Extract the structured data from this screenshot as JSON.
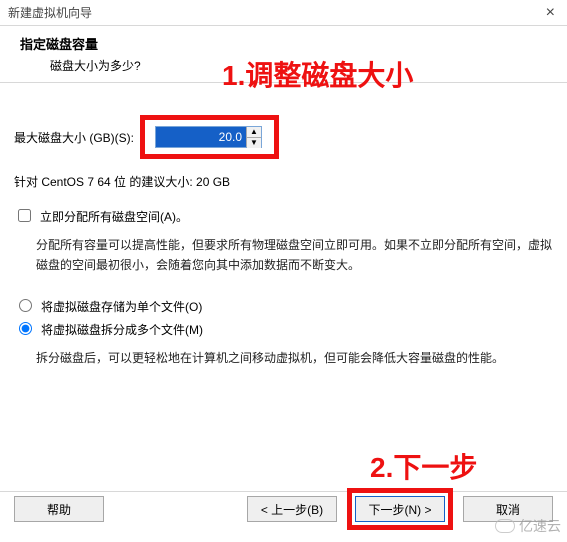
{
  "window": {
    "title": "新建虚拟机向导",
    "close_glyph": "×"
  },
  "header": {
    "title": "指定磁盘容量",
    "subtitle": "磁盘大小为多少?"
  },
  "disk": {
    "label": "最大磁盘大小 (GB)(S):",
    "value": "20.0",
    "spin_up": "▲",
    "spin_down": "▼",
    "recommendation": "针对 CentOS 7 64 位 的建议大小: 20 GB"
  },
  "allocate": {
    "checkbox_label": "立即分配所有磁盘空间(A)。",
    "description": "分配所有容量可以提高性能，但要求所有物理磁盘空间立即可用。如果不立即分配所有空间，虚拟磁盘的空间最初很小，会随着您向其中添加数据而不断变大。"
  },
  "split": {
    "single_label": "将虚拟磁盘存储为单个文件(O)",
    "multi_label": "将虚拟磁盘拆分成多个文件(M)",
    "description": "拆分磁盘后，可以更轻松地在计算机之间移动虚拟机，但可能会降低大容量磁盘的性能。"
  },
  "buttons": {
    "help": "帮助",
    "back": "< 上一步(B)",
    "next": "下一步(N) >",
    "cancel": "取消"
  },
  "annotations": {
    "a1": "1.调整磁盘大小",
    "a2": "2.下一步"
  },
  "watermark": "亿速云"
}
